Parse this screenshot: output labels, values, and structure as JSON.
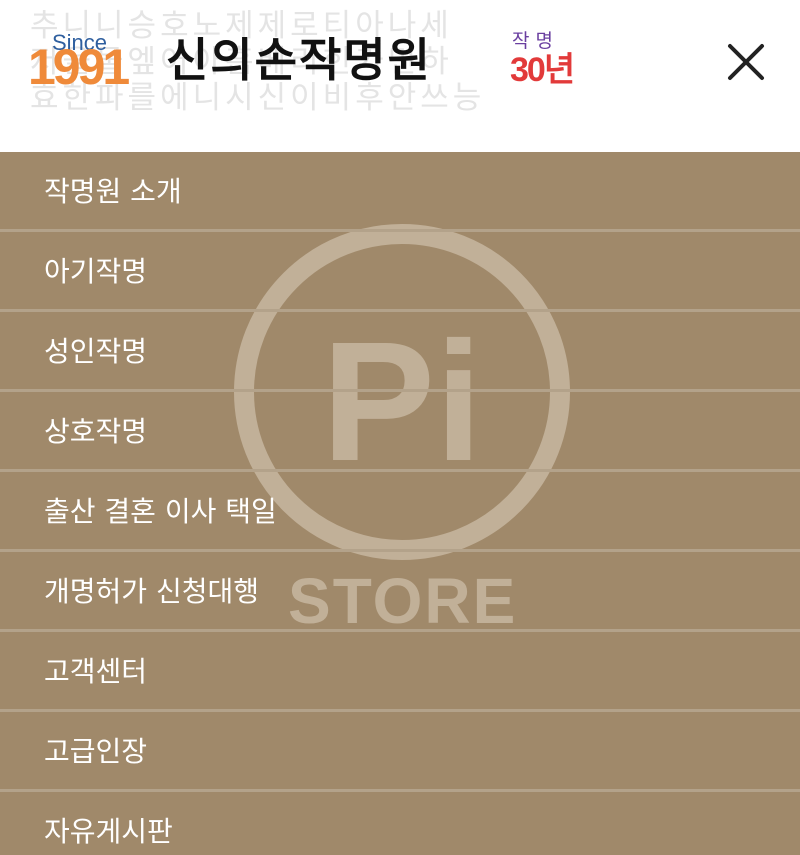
{
  "header": {
    "background_text_rows": [
      "추니니승호노제제로티아나세",
      "저을물엪어아흡베리힌가민하",
      "효한파를에니시신이비후안쓰능"
    ],
    "logo": {
      "since": "Since",
      "year": "1991",
      "brand": "신의손작명원",
      "badge_top": "작명",
      "badge_bottom": "30년"
    },
    "close_icon": "close-icon"
  },
  "menu": {
    "items": [
      {
        "label": "작명원 소개"
      },
      {
        "label": "아기작명"
      },
      {
        "label": "성인작명"
      },
      {
        "label": "상호작명"
      },
      {
        "label": "출산 결혼 이사 택일"
      },
      {
        "label": "개명허가 신청대행"
      },
      {
        "label": "고객센터"
      },
      {
        "label": "고급인장"
      },
      {
        "label": "자유게시판"
      }
    ]
  },
  "watermark": {
    "mark": "Pi",
    "text": "STORE"
  },
  "colors": {
    "menu_background": "#a0896a",
    "menu_divider": "#b3a28a",
    "menu_text": "#ffffff",
    "year_orange": "#ef8a3a",
    "since_blue": "#2f5f9f",
    "badge_purple": "#6a3fa0",
    "badge_red": "#e23a3a"
  }
}
